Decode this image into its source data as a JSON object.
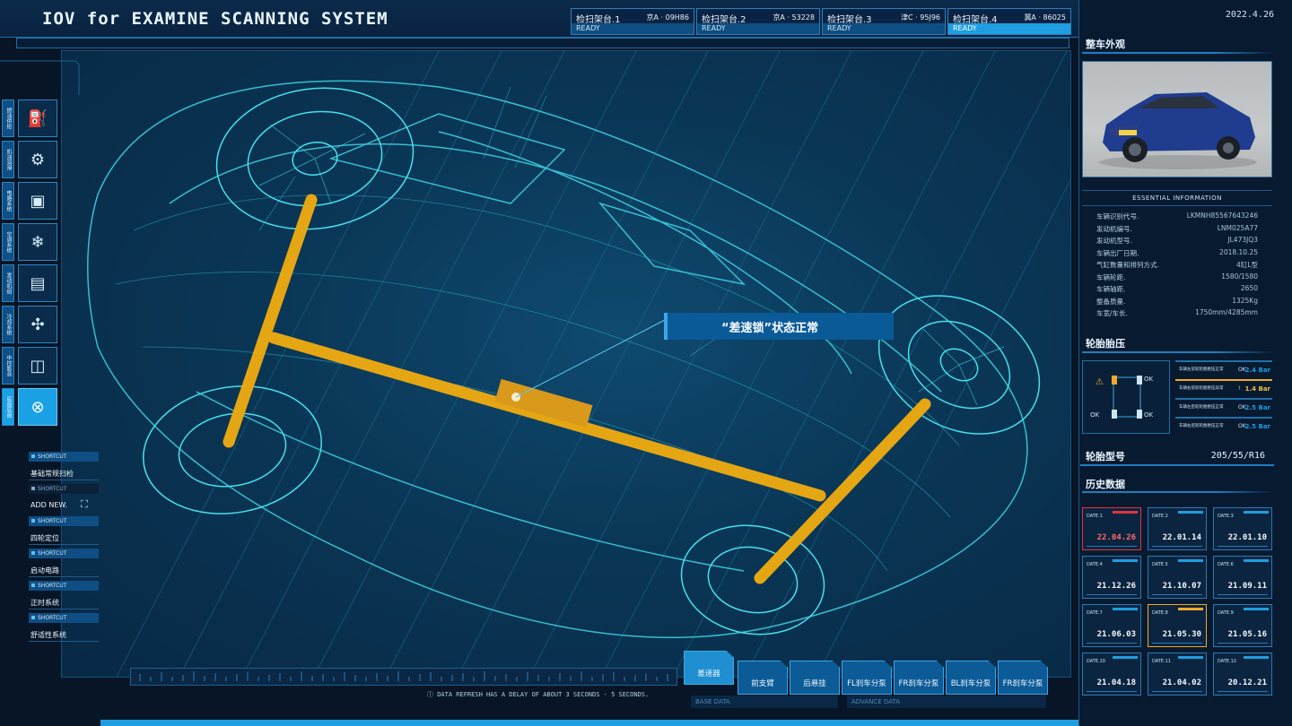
{
  "header": {
    "title": "IOV for EXAMINE SCANNING SYSTEM",
    "date": "2022.4.26"
  },
  "bays": [
    {
      "name": "检扫架台.1",
      "plate": "京A · 09H86",
      "status": "READY"
    },
    {
      "name": "检扫架台.2",
      "plate": "京A · 53228",
      "status": "READY"
    },
    {
      "name": "检扫架台.3",
      "plate": "津C · 95J96",
      "status": "READY"
    },
    {
      "name": "检扫架台.4",
      "plate": "冀A · 86025",
      "status": "READY"
    }
  ],
  "sidebar": {
    "items": [
      {
        "label": "燃油供给",
        "icon": "fuel-pump-icon"
      },
      {
        "label": "机油润滑",
        "icon": "oil-gear-icon"
      },
      {
        "label": "电路系统",
        "icon": "chip-icon"
      },
      {
        "label": "空调系统",
        "icon": "snowflake-icon"
      },
      {
        "label": "发动机组",
        "icon": "engine-icon"
      },
      {
        "label": "冷却系统",
        "icon": "fan-icon"
      },
      {
        "label": "中控影音",
        "icon": "media-icon"
      },
      {
        "label": "底盘底盘",
        "icon": "chassis-icon"
      }
    ]
  },
  "shortcuts": [
    {
      "tag": "SHORTCUT",
      "name": "基础常规扫检"
    },
    {
      "tag": "SHORTCUT",
      "name": "ADD NEW."
    },
    {
      "tag": "SHORTCUT",
      "name": "四轮定位"
    },
    {
      "tag": "SHORTCUT",
      "name": "启动电路"
    },
    {
      "tag": "SHORTCUT",
      "name": "正时系统"
    },
    {
      "tag": "SHORTCUT",
      "name": "舒适性系统"
    }
  ],
  "callout": {
    "text": "“差速锁”状态正常"
  },
  "bottom": {
    "refresh_note": "DATA REFRESH HAS A DELAY OF ABOUT 3 SECONDS - 5 SECONDS.",
    "base_data": "BASE DATA",
    "advance_data": "ADVANCE DATA",
    "tabs": [
      "差速器",
      "前支臂",
      "后悬挂",
      "FL刹车分泵",
      "FR刹车分泵",
      "BL刹车分泵",
      "FR刹车分泵"
    ]
  },
  "right": {
    "appearance_title": "整车外观",
    "essential_title": "ESSENTIAL INFORMATION",
    "info": [
      {
        "k": "车辆识别代号.",
        "v": "LKMNH85567643246"
      },
      {
        "k": "发动机编号.",
        "v": "LNM025A77"
      },
      {
        "k": "发动机型号.",
        "v": "JL473JQ3"
      },
      {
        "k": "车辆出厂日期.",
        "v": "2018.10.25"
      },
      {
        "k": "气缸数量和排列方式.",
        "v": "4缸L型"
      },
      {
        "k": "车辆轮距.",
        "v": "1580/1580"
      },
      {
        "k": "车辆轴距.",
        "v": "2650"
      },
      {
        "k": "整备质量.",
        "v": "1325Kg"
      },
      {
        "k": "车宽/车长.",
        "v": "1750mm/4285mm"
      }
    ],
    "tire_title": "轮胎胎压",
    "tire_box": {
      "ok_tl": "OK",
      "ok_bl": "OK",
      "ok_br": "OK"
    },
    "tires": [
      {
        "label": "车辆左前轮轮胎胎压正常",
        "ok": "OK",
        "value": "2.4 Bar",
        "warn": false
      },
      {
        "label": "车辆右前轮轮胎胎压异常",
        "ok": "!",
        "value": "1.4 Bar",
        "warn": true
      },
      {
        "label": "车辆左后轮轮胎胎压正常",
        "ok": "OK",
        "value": "2.5 Bar",
        "warn": false
      },
      {
        "label": "车辆右后轮轮胎胎压正常",
        "ok": "OK",
        "value": "2.5 Bar",
        "warn": false
      }
    ],
    "tire_spec_label": "轮胎型号",
    "tire_spec_value": "205/55/R16",
    "history_title": "历史数据",
    "history": [
      {
        "label": "DATE.1",
        "date": "22.04.26",
        "state": "red"
      },
      {
        "label": "DATE.2",
        "date": "22.01.14",
        "state": "normal"
      },
      {
        "label": "DATE.3",
        "date": "22.01.10",
        "state": "normal"
      },
      {
        "label": "DATE.4",
        "date": "21.12.26",
        "state": "normal"
      },
      {
        "label": "DATE.5",
        "date": "21.10.07",
        "state": "normal"
      },
      {
        "label": "DATE.6",
        "date": "21.09.11",
        "state": "normal"
      },
      {
        "label": "DATE.7",
        "date": "21.06.03",
        "state": "normal"
      },
      {
        "label": "DATE.8",
        "date": "21.05.30",
        "state": "orange"
      },
      {
        "label": "DATE.9",
        "date": "21.05.16",
        "state": "normal"
      },
      {
        "label": "DATE.10",
        "date": "21.04.18",
        "state": "normal"
      },
      {
        "label": "DATE.11",
        "date": "21.04.02",
        "state": "normal"
      },
      {
        "label": "DATE.12",
        "date": "20.12.21",
        "state": "normal"
      }
    ]
  },
  "colors": {
    "accent": "#1e9ee0",
    "warn": "#f0a92a",
    "alert": "#e0343d",
    "axle": "#e5a613"
  }
}
